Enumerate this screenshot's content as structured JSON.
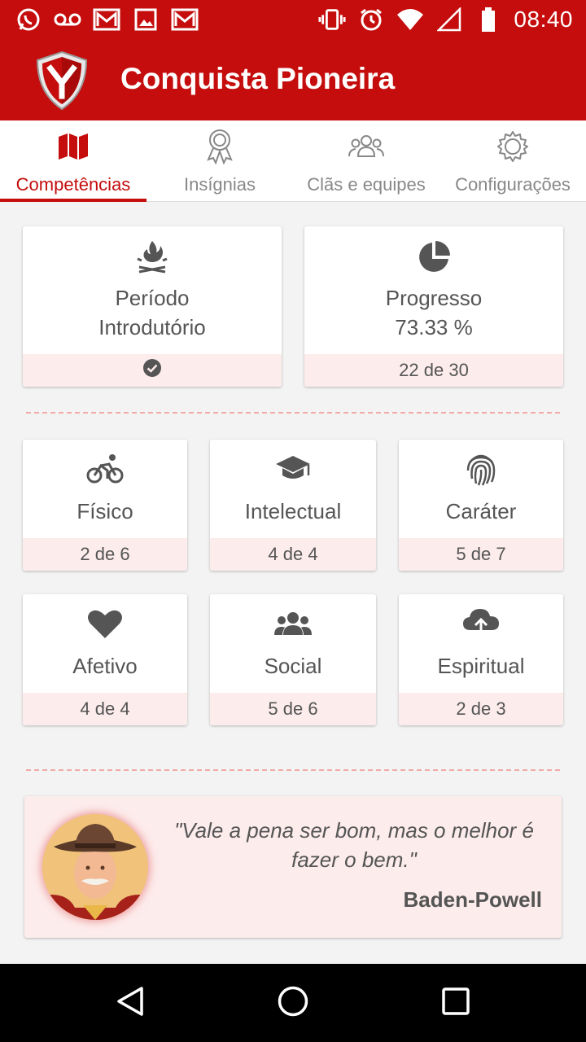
{
  "status_bar": {
    "time": "08:40",
    "left_icons": [
      "whatsapp-icon",
      "voicemail-icon",
      "gmail-icon",
      "image-icon",
      "gmail-icon"
    ],
    "right_icons": [
      "vibrate-icon",
      "alarm-icon",
      "wifi-icon",
      "signal-icon",
      "battery-icon"
    ]
  },
  "app": {
    "title": "Conquista Pioneira",
    "brand_color": "#c50d0d"
  },
  "tabs": [
    {
      "label": "Competências",
      "icon": "map-icon",
      "active": true
    },
    {
      "label": "Insígnias",
      "icon": "badge-icon",
      "active": false
    },
    {
      "label": "Clãs e equipes",
      "icon": "group-icon",
      "active": false
    },
    {
      "label": "Configurações",
      "icon": "gear-icon",
      "active": false
    }
  ],
  "summary": {
    "period": {
      "line1": "Período",
      "line2": "Introdutório",
      "status_icon": "check-circle-icon",
      "icon": "campfire-icon"
    },
    "progress": {
      "label": "Progresso",
      "value": "73.33 %",
      "count": "22 de 30",
      "icon": "pie-chart-icon"
    }
  },
  "areas": [
    {
      "name": "Físico",
      "count": "2 de 6",
      "icon": "bicycle-icon"
    },
    {
      "name": "Intelectual",
      "count": "4 de 4",
      "icon": "graduation-cap-icon"
    },
    {
      "name": "Caráter",
      "count": "5 de 7",
      "icon": "fingerprint-icon"
    },
    {
      "name": "Afetivo",
      "count": "4 de 4",
      "icon": "heart-icon"
    },
    {
      "name": "Social",
      "count": "5 de 6",
      "icon": "users-icon"
    },
    {
      "name": "Espiritual",
      "count": "2 de 3",
      "icon": "cloud-upload-icon"
    }
  ],
  "quote": {
    "text": "\"Vale a pena ser bom, mas o melhor é fazer o bem.\"",
    "author": "Baden-Powell"
  }
}
